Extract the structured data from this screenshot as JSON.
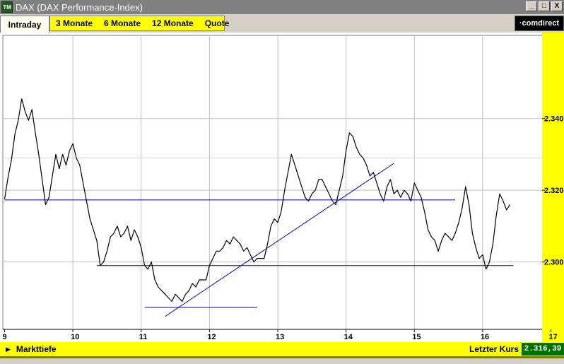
{
  "window": {
    "icon_label": "TM",
    "title": "DAX (DAX Performance-Index)",
    "buttons": [
      "_",
      "□",
      "X"
    ]
  },
  "tabs": {
    "active": "Intraday",
    "items": [
      "3 Monate",
      "6 Monate",
      "12 Monate",
      "Quote"
    ]
  },
  "logo": "·comdirect",
  "footer": {
    "marktiefe_label": "Markttiefe",
    "letzter_kurs_label": "Letzter Kurs",
    "letzter_kurs_value": "2.316,39"
  },
  "colors": {
    "price_line": "#000000",
    "support_lines": "#0000aa",
    "reference_line": "#eeee00",
    "y_axis_band": "#ffff00",
    "last_price_badge": "#007000"
  },
  "chart_data": {
    "type": "line",
    "xlabel": "",
    "ylabel": "",
    "x_ticks": [
      "9",
      "10",
      "11",
      "12",
      "13",
      "14",
      "15",
      "16",
      "17"
    ],
    "y_ticks": [
      "2.340",
      "2.320",
      "2.300"
    ],
    "xlim": [
      9,
      17
    ],
    "ylim": [
      2.2812,
      2.3632
    ],
    "grid": true,
    "series": [
      {
        "values": [
          [
            9.0,
            2.3175
          ],
          [
            9.05,
            2.3235
          ],
          [
            9.1,
            2.3285
          ],
          [
            9.15,
            2.3355
          ],
          [
            9.2,
            2.3395
          ],
          [
            9.25,
            2.3455
          ],
          [
            9.3,
            2.342
          ],
          [
            9.35,
            2.3395
          ],
          [
            9.4,
            2.3425
          ],
          [
            9.45,
            2.336
          ],
          [
            9.5,
            2.33
          ],
          [
            9.55,
            2.323
          ],
          [
            9.6,
            2.316
          ],
          [
            9.65,
            2.318
          ],
          [
            9.7,
            2.324
          ],
          [
            9.75,
            2.33
          ],
          [
            9.8,
            2.326
          ],
          [
            9.85,
            2.33
          ],
          [
            9.9,
            2.327
          ],
          [
            9.95,
            2.331
          ],
          [
            10.0,
            2.333
          ],
          [
            10.05,
            2.329
          ],
          [
            10.1,
            2.327
          ],
          [
            10.15,
            2.322
          ],
          [
            10.2,
            2.317
          ],
          [
            10.25,
            2.312
          ],
          [
            10.3,
            2.309
          ],
          [
            10.35,
            2.306
          ],
          [
            10.4,
            2.299
          ],
          [
            10.45,
            2.3
          ],
          [
            10.5,
            2.303
          ],
          [
            10.55,
            2.307
          ],
          [
            10.6,
            2.308
          ],
          [
            10.65,
            2.31
          ],
          [
            10.7,
            2.307
          ],
          [
            10.75,
            2.308
          ],
          [
            10.8,
            2.31
          ],
          [
            10.85,
            2.306
          ],
          [
            10.9,
            2.309
          ],
          [
            10.95,
            2.307
          ],
          [
            11.0,
            2.304
          ],
          [
            11.05,
            2.299
          ],
          [
            11.1,
            2.298
          ],
          [
            11.15,
            2.3
          ],
          [
            11.2,
            2.295
          ],
          [
            11.25,
            2.293
          ],
          [
            11.3,
            2.292
          ],
          [
            11.35,
            2.291
          ],
          [
            11.4,
            2.29
          ],
          [
            11.45,
            2.289
          ],
          [
            11.5,
            2.291
          ],
          [
            11.55,
            2.29
          ],
          [
            11.6,
            2.289
          ],
          [
            11.65,
            2.291
          ],
          [
            11.7,
            2.292
          ],
          [
            11.75,
            2.294
          ],
          [
            11.8,
            2.293
          ],
          [
            11.85,
            2.295
          ],
          [
            11.9,
            2.295
          ],
          [
            11.95,
            2.295
          ],
          [
            12.0,
            2.299
          ],
          [
            12.05,
            2.301
          ],
          [
            12.1,
            2.303
          ],
          [
            12.15,
            2.303
          ],
          [
            12.2,
            2.304
          ],
          [
            12.25,
            2.306
          ],
          [
            12.3,
            2.305
          ],
          [
            12.35,
            2.307
          ],
          [
            12.4,
            2.306
          ],
          [
            12.45,
            2.305
          ],
          [
            12.5,
            2.303
          ],
          [
            12.55,
            2.304
          ],
          [
            12.6,
            2.302
          ],
          [
            12.65,
            2.3
          ],
          [
            12.7,
            2.301
          ],
          [
            12.75,
            2.301
          ],
          [
            12.8,
            2.301
          ],
          [
            12.85,
            2.305
          ],
          [
            12.9,
            2.31
          ],
          [
            12.95,
            2.312
          ],
          [
            13.0,
            2.311
          ],
          [
            13.05,
            2.314
          ],
          [
            13.1,
            2.32
          ],
          [
            13.15,
            2.325
          ],
          [
            13.2,
            2.33
          ],
          [
            13.25,
            2.327
          ],
          [
            13.3,
            2.324
          ],
          [
            13.35,
            2.321
          ],
          [
            13.4,
            2.318
          ],
          [
            13.45,
            2.317
          ],
          [
            13.5,
            2.319
          ],
          [
            13.55,
            2.32
          ],
          [
            13.6,
            2.323
          ],
          [
            13.65,
            2.323
          ],
          [
            13.7,
            2.321
          ],
          [
            13.75,
            2.319
          ],
          [
            13.8,
            2.317
          ],
          [
            13.85,
            2.316
          ],
          [
            13.9,
            2.32
          ],
          [
            13.95,
            2.324
          ],
          [
            14.0,
            2.331
          ],
          [
            14.05,
            2.336
          ],
          [
            14.1,
            2.335
          ],
          [
            14.15,
            2.332
          ],
          [
            14.2,
            2.33
          ],
          [
            14.25,
            2.329
          ],
          [
            14.3,
            2.327
          ],
          [
            14.35,
            2.324
          ],
          [
            14.4,
            2.325
          ],
          [
            14.45,
            2.322
          ],
          [
            14.5,
            2.319
          ],
          [
            14.55,
            2.317
          ],
          [
            14.6,
            2.321
          ],
          [
            14.65,
            2.323
          ],
          [
            14.7,
            2.319
          ],
          [
            14.75,
            2.32
          ],
          [
            14.8,
            2.318
          ],
          [
            14.85,
            2.32
          ],
          [
            14.9,
            2.319
          ],
          [
            14.95,
            2.317
          ],
          [
            15.0,
            2.322
          ],
          [
            15.05,
            2.32
          ],
          [
            15.1,
            2.318
          ],
          [
            15.15,
            2.314
          ],
          [
            15.2,
            2.309
          ],
          [
            15.25,
            2.307
          ],
          [
            15.3,
            2.306
          ],
          [
            15.35,
            2.303
          ],
          [
            15.4,
            2.306
          ],
          [
            15.45,
            2.308
          ],
          [
            15.5,
            2.307
          ],
          [
            15.55,
            2.306
          ],
          [
            15.6,
            2.308
          ],
          [
            15.65,
            2.311
          ],
          [
            15.7,
            2.315
          ],
          [
            15.75,
            2.321
          ],
          [
            15.8,
            2.316
          ],
          [
            15.85,
            2.308
          ],
          [
            15.9,
            2.304
          ],
          [
            15.95,
            2.301
          ],
          [
            16.0,
            2.302
          ],
          [
            16.05,
            2.298
          ],
          [
            16.1,
            2.3
          ],
          [
            16.15,
            2.305
          ],
          [
            16.2,
            2.313
          ],
          [
            16.25,
            2.319
          ],
          [
            16.3,
            2.317
          ],
          [
            16.35,
            2.3145
          ],
          [
            16.4,
            2.316
          ]
        ]
      }
    ],
    "reference_lines": [
      {
        "kind": "horizontal",
        "y": 2.329,
        "x_from": 9.0,
        "x_to": 17.2,
        "color": "#eeee00"
      },
      {
        "kind": "horizontal",
        "y": 2.3173,
        "x_from": 9.0,
        "x_to": 15.6,
        "color": "#0000aa"
      },
      {
        "kind": "horizontal",
        "y": 2.299,
        "x_from": 10.35,
        "x_to": 16.45,
        "color": "#0000aa"
      },
      {
        "kind": "horizontal",
        "y": 2.2873,
        "x_from": 11.05,
        "x_to": 12.7,
        "color": "#0000aa"
      },
      {
        "kind": "trendline",
        "x1": 11.35,
        "y1": 2.2848,
        "x2": 14.7,
        "y2": 2.3275,
        "color": "#0000aa"
      }
    ]
  }
}
